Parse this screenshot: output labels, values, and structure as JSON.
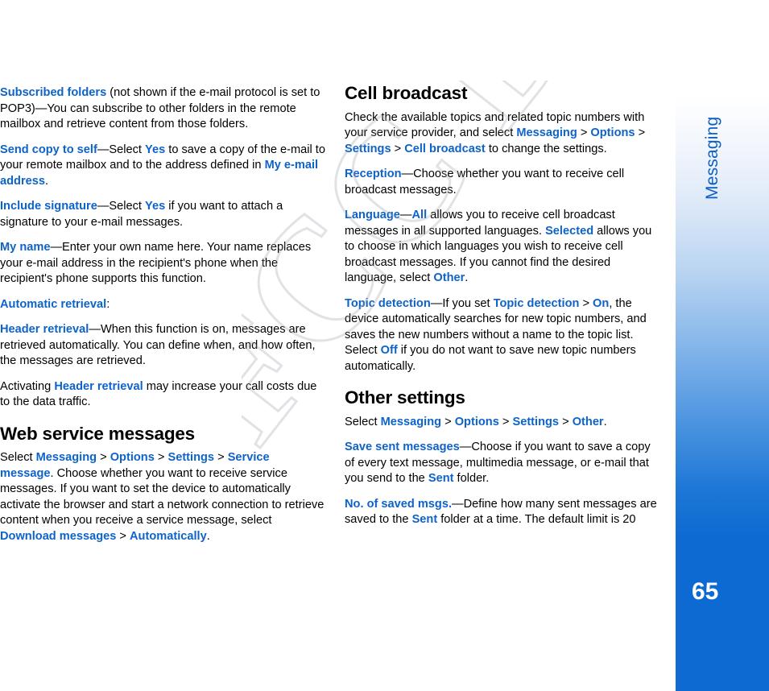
{
  "document": {
    "page_number": "65",
    "sidebar_label": "Messaging",
    "watermark_text": "FCC Draft"
  },
  "left_column": {
    "paragraphs": [
      [
        {
          "t": "Subscribed folders",
          "b": true
        },
        {
          "t": " (not shown if the e-mail protocol is set to POP3)—You can subscribe to other folders in the remote mailbox and retrieve content from those folders.",
          "b": false
        }
      ],
      [
        {
          "t": "Send copy to self",
          "b": true
        },
        {
          "t": "—Select ",
          "b": false
        },
        {
          "t": "Yes",
          "b": true
        },
        {
          "t": " to save a copy of the e-mail to your remote mailbox and to the address defined in ",
          "b": false
        },
        {
          "t": "My e-mail address",
          "b": true
        },
        {
          "t": ".",
          "b": false
        }
      ],
      [
        {
          "t": "Include signature",
          "b": true
        },
        {
          "t": "—Select ",
          "b": false
        },
        {
          "t": "Yes",
          "b": true
        },
        {
          "t": " if you want to attach a signature to your e-mail messages.",
          "b": false
        }
      ],
      [
        {
          "t": "My name",
          "b": true
        },
        {
          "t": "—Enter your own name here. Your name replaces your e-mail address in the recipient's phone when the recipient's phone supports this function.",
          "b": false
        }
      ],
      [
        {
          "t": "Automatic retrieval",
          "b": true
        },
        {
          "t": ":",
          "b": false
        }
      ],
      [
        {
          "t": "Header retrieval",
          "b": true
        },
        {
          "t": "—When this function is on, messages are retrieved automatically. You can define when, and how often, the messages are retrieved.",
          "b": false
        }
      ],
      [
        {
          "t": "Activating ",
          "b": false
        },
        {
          "t": "Header retrieval",
          "b": true
        },
        {
          "t": " may increase your call costs due to the data traffic.",
          "b": false
        }
      ]
    ],
    "heading": "Web service messages",
    "after_heading": [
      [
        {
          "t": "Select ",
          "b": false
        },
        {
          "t": "Messaging",
          "b": true
        },
        {
          "t": " > ",
          "b": false
        },
        {
          "t": "Options",
          "b": true
        },
        {
          "t": " > ",
          "b": false
        },
        {
          "t": "Settings",
          "b": true
        },
        {
          "t": " > ",
          "b": false
        },
        {
          "t": "Service message",
          "b": true
        },
        {
          "t": ". Choose whether you want to receive service messages. If you want to set the device to automatically activate the browser and start a network connection to retrieve content when you receive a service message, select ",
          "b": false
        },
        {
          "t": "Download messages",
          "b": true
        },
        {
          "t": " > ",
          "b": false
        },
        {
          "t": "Automatically",
          "b": true
        },
        {
          "t": ".",
          "b": false
        }
      ]
    ]
  },
  "right_column": {
    "heading_1": "Cell broadcast",
    "paragraphs_1": [
      [
        {
          "t": "Check the available topics and related topic numbers with your service provider, and select ",
          "b": false
        },
        {
          "t": "Messaging",
          "b": true
        },
        {
          "t": " > ",
          "b": false
        },
        {
          "t": "Options",
          "b": true
        },
        {
          "t": " > ",
          "b": false
        },
        {
          "t": "Settings",
          "b": true
        },
        {
          "t": " > ",
          "b": false
        },
        {
          "t": "Cell broadcast",
          "b": true
        },
        {
          "t": " to change the settings.",
          "b": false
        }
      ],
      [
        {
          "t": "Reception",
          "b": true
        },
        {
          "t": "—Choose whether you want to receive cell broadcast messages.",
          "b": false
        }
      ],
      [
        {
          "t": "Language",
          "b": true
        },
        {
          "t": "—",
          "b": false
        },
        {
          "t": "All",
          "b": true
        },
        {
          "t": " allows you to receive cell broadcast messages in all supported languages. ",
          "b": false
        },
        {
          "t": "Selected",
          "b": true
        },
        {
          "t": " allows you to choose in which languages you wish to receive cell broadcast messages. If you cannot find the desired language, select ",
          "b": false
        },
        {
          "t": "Other",
          "b": true
        },
        {
          "t": ".",
          "b": false
        }
      ],
      [
        {
          "t": "Topic detection",
          "b": true
        },
        {
          "t": "—If you set ",
          "b": false
        },
        {
          "t": "Topic detection",
          "b": true
        },
        {
          "t": " > ",
          "b": false
        },
        {
          "t": "On",
          "b": true
        },
        {
          "t": ", the device automatically searches for new topic numbers, and saves the new numbers without a name to the topic list. Select ",
          "b": false
        },
        {
          "t": "Off",
          "b": true
        },
        {
          "t": " if you do not want to save new topic numbers automatically.",
          "b": false
        }
      ]
    ],
    "heading_2": "Other settings",
    "paragraphs_2": [
      [
        {
          "t": "Select ",
          "b": false
        },
        {
          "t": "Messaging",
          "b": true
        },
        {
          "t": " > ",
          "b": false
        },
        {
          "t": "Options",
          "b": true
        },
        {
          "t": " > ",
          "b": false
        },
        {
          "t": "Settings",
          "b": true
        },
        {
          "t": " > ",
          "b": false
        },
        {
          "t": "Other",
          "b": true
        },
        {
          "t": ".",
          "b": false
        }
      ],
      [
        {
          "t": "Save sent messages",
          "b": true
        },
        {
          "t": "—Choose if you want to save a copy of every text message, multimedia message, or e-mail that you send to the ",
          "b": false
        },
        {
          "t": "Sent",
          "b": true
        },
        {
          "t": " folder.",
          "b": false
        }
      ],
      [
        {
          "t": "No. of saved msgs.",
          "b": true
        },
        {
          "t": "—Define how many sent messages are saved to the ",
          "b": false
        },
        {
          "t": "Sent",
          "b": true
        },
        {
          "t": " folder at a time. The default limit is 20",
          "b": false
        }
      ]
    ]
  }
}
